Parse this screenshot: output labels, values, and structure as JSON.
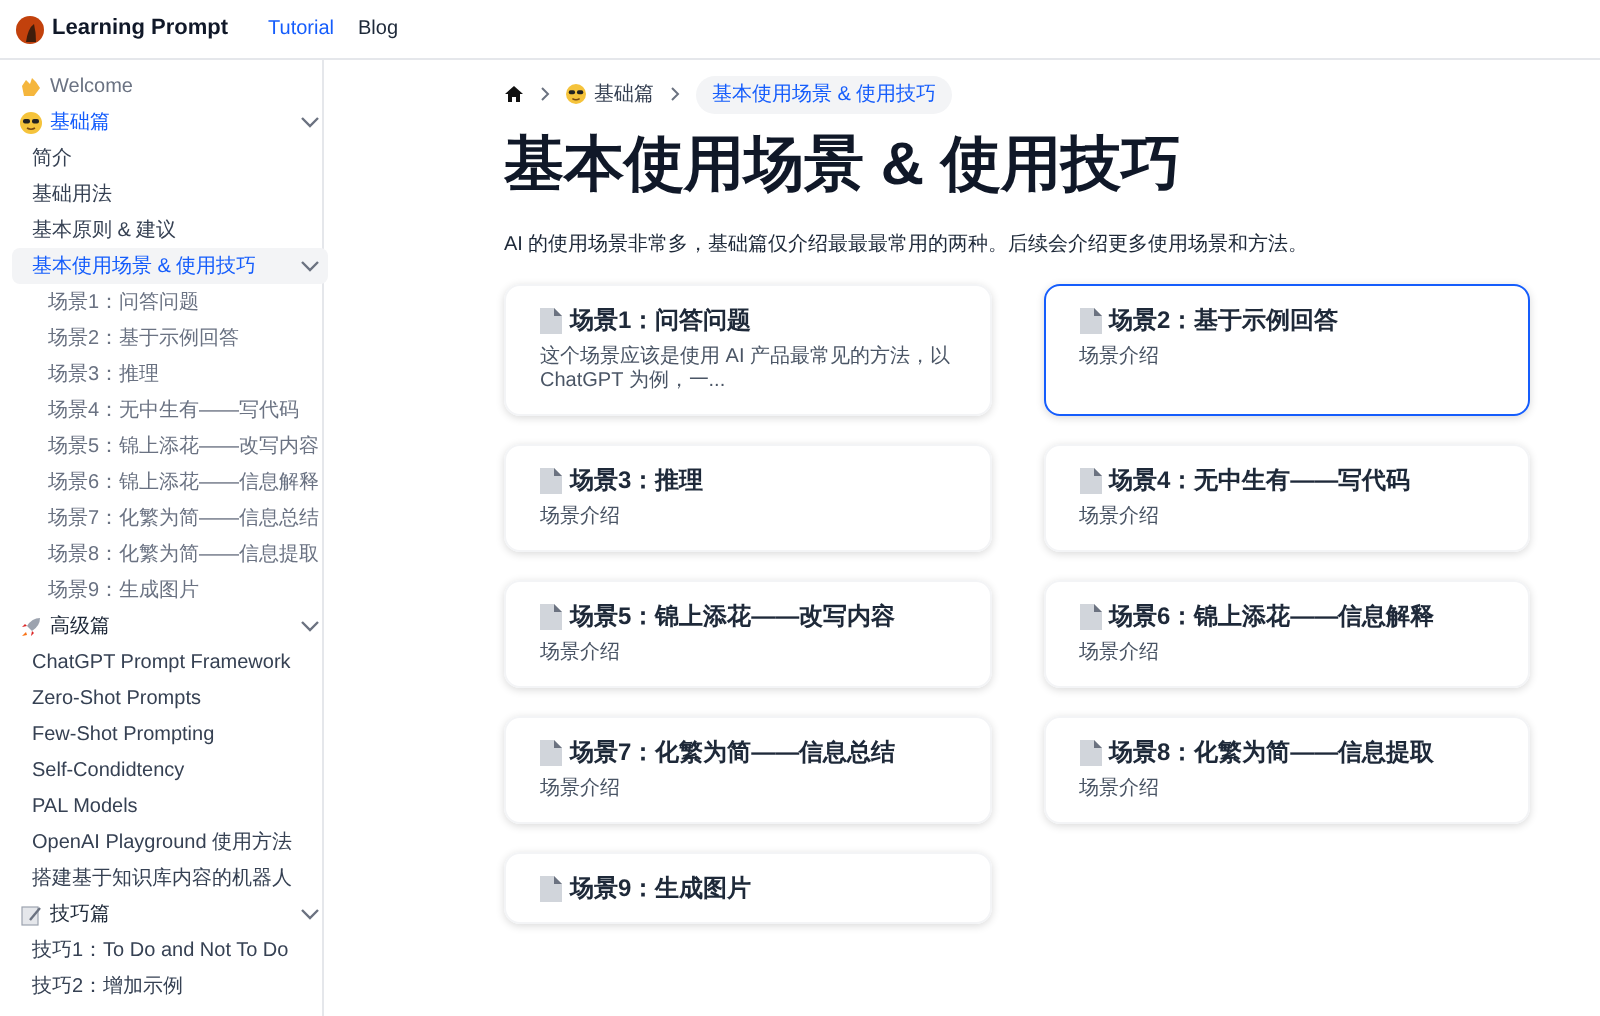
{
  "header": {
    "brand": "Learning Prompt",
    "nav": [
      {
        "label": "Tutorial",
        "selected": true
      },
      {
        "label": "Blog",
        "selected": false
      }
    ]
  },
  "sidebar": {
    "items": [
      {
        "label": "Welcome",
        "kind": "link",
        "selected": false
      },
      {
        "label": "基础篇",
        "kind": "section",
        "selected": true,
        "expanded": true,
        "children": [
          {
            "label": "简介",
            "selected": false
          },
          {
            "label": "基础用法",
            "selected": false
          },
          {
            "label": "基本原则 & 建议",
            "selected": false
          },
          {
            "label": "基本使用场景 & 使用技巧",
            "selected": true,
            "expanded": true,
            "children": [
              {
                "label": "场景1：问答问题",
                "selected": false
              },
              {
                "label": "场景2：基于示例回答",
                "selected": false
              },
              {
                "label": "场景3：推理",
                "selected": false
              },
              {
                "label": "场景4：无中生有——写代码",
                "selected": false
              },
              {
                "label": "场景5：锦上添花——改写内容",
                "selected": false
              },
              {
                "label": "场景6：锦上添花——信息解释",
                "selected": false
              },
              {
                "label": "场景7：化繁为简——信息总结",
                "selected": false
              },
              {
                "label": "场景8：化繁为简——信息提取",
                "selected": false
              },
              {
                "label": "场景9：生成图片",
                "selected": false
              }
            ]
          }
        ]
      },
      {
        "label": "高级篇",
        "kind": "section",
        "selected": false,
        "expanded": true,
        "children": [
          {
            "label": "ChatGPT Prompt Framework",
            "selected": false
          },
          {
            "label": "Zero-Shot Prompts",
            "selected": false
          },
          {
            "label": "Few-Shot Prompting",
            "selected": false
          },
          {
            "label": "Self-Condidtency",
            "selected": false
          },
          {
            "label": "PAL Models",
            "selected": false
          },
          {
            "label": "OpenAI Playground 使用方法",
            "selected": false
          },
          {
            "label": "搭建基于知识库内容的机器人",
            "selected": false
          }
        ]
      },
      {
        "label": "技巧篇",
        "kind": "section",
        "selected": false,
        "expanded": true,
        "children": [
          {
            "label": "技巧1：To Do and Not To Do",
            "selected": false
          },
          {
            "label": "技巧2：增加示例",
            "selected": false
          }
        ]
      }
    ]
  },
  "breadcrumb": [
    "基础篇",
    "基本使用场景 & 使用技巧"
  ],
  "title": "基本使用场景 & 使用技巧",
  "intro": "AI 的使用场景非常多，基础篇仅介绍最最最常用的两种。后续会介绍更多使用场景和方法。",
  "cards": [
    {
      "title": "场景1：问答问题",
      "description": "这个场景应该是使用 AI 产品最常见的方法，以 ChatGPT 为例，一...",
      "selected": false
    },
    {
      "title": "场景2：基于示例回答",
      "description": "场景介绍",
      "selected": true
    },
    {
      "title": "场景3：推理",
      "description": "场景介绍",
      "selected": false
    },
    {
      "title": "场景4：无中生有——写代码",
      "description": "场景介绍",
      "selected": false
    },
    {
      "title": "场景5：锦上添花——改写内容",
      "description": "场景介绍",
      "selected": false
    },
    {
      "title": "场景6：锦上添花——信息解释",
      "description": "场景介绍",
      "selected": false
    },
    {
      "title": "场景7：化繁为简——信息总结",
      "description": "场景介绍",
      "selected": false
    },
    {
      "title": "场景8：化繁为简——信息提取",
      "description": "场景介绍",
      "selected": false
    },
    {
      "title": "场景9：生成图片",
      "selected": false
    }
  ]
}
